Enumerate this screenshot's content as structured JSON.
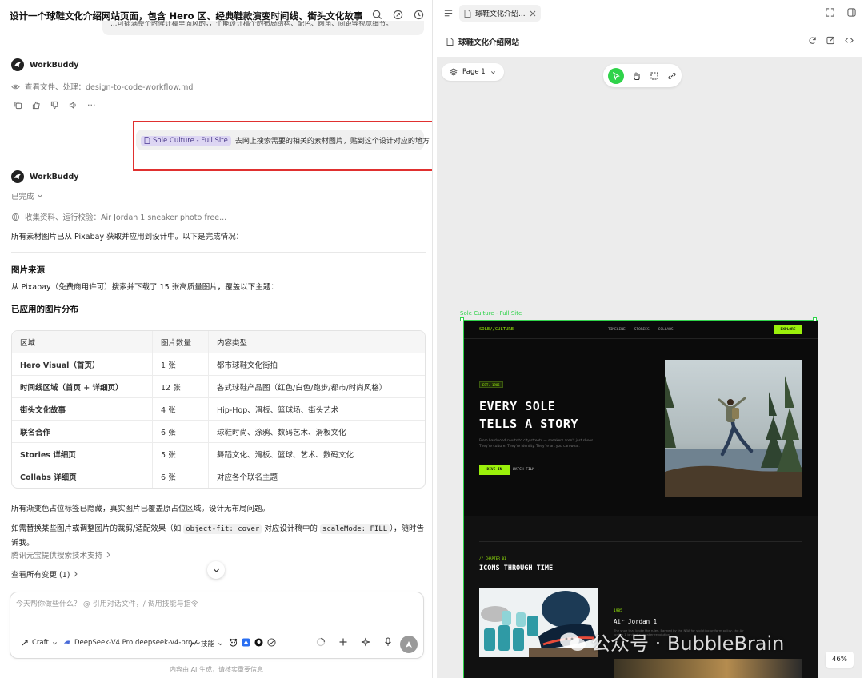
{
  "chat": {
    "title": "设计一个球鞋文化介绍网站页面，包含 Hero 区、经典鞋款演变时间线、街头文化故事、标志...",
    "prev_message_fragment": "…可插满整个时候计稿里面风的，，个能设计稿个的布局结构、配色、圆角、间距等视觉细节。",
    "agent_name": "WorkBuddy",
    "step1": "查看文件、处理：design-to-code-workflow.md",
    "user_msg": {
      "chip": "Sole Culture - Full Site",
      "text": "去网上搜索需要的相关的素材图片，贴到这个设计对应的地方"
    },
    "status": "已完成",
    "step2": "收集资料、运行校验：Air Jordan 1 sneaker photo free...",
    "intro": "所有素材图片已从 Pixabay 获取并应用到设计中。以下是完成情况：",
    "h_source": "图片来源",
    "p_source": "从 Pixabay（免费商用许可）搜索并下载了 15 张高质量图片，覆盖以下主题：",
    "h_dist": "已应用的图片分布",
    "table": {
      "headers": [
        "区域",
        "图片数量",
        "内容类型"
      ],
      "rows": [
        [
          "Hero Visual（首页）",
          "1 张",
          "都市球鞋文化街拍"
        ],
        [
          "时间线区域（首页 + 详细页）",
          "12 张",
          "各式球鞋产品图（红色/白色/跑步/都市/时尚风格）"
        ],
        [
          "街头文化故事",
          "4 张",
          "Hip-Hop、滑板、篮球场、街头艺术"
        ],
        [
          "联名合作",
          "6 张",
          "球鞋时尚、涂鸦、数码艺术、滑板文化"
        ],
        [
          "Stories 详细页",
          "5 张",
          "舞蹈文化、滑板、篮球、艺术、数码文化"
        ],
        [
          "Collabs 详细页",
          "6 张",
          "对应各个联名主题"
        ]
      ]
    },
    "p_hidden": "所有渐变色占位标签已隐藏，真实图片已覆盖原占位区域。设计无布局问题。",
    "p_replace_a": "如需替换某些图片或调整图片的裁剪/适配效果（如 ",
    "code1": "object-fit: cover",
    "p_replace_b": " 对应设计稿中的 ",
    "code2": "scaleMode: FILL",
    "p_replace_c": "），随时告诉我。",
    "tencent": "腾讯元宝提供搜索技术支持",
    "changes": "查看所有变更 (1)",
    "input_placeholder": "今天帮你做些什么？ @ 引用对话文件，/ 调用技能与指令",
    "tool_craft": "Craft",
    "tool_model": "DeepSeek-V4 Pro:deepseek-v4-pro",
    "tool_skill": "技能",
    "footer": "内容由 AI 生成，请核实重要信息"
  },
  "preview": {
    "tab_label": "球鞋文化介绍...",
    "page_title": "球鞋文化介绍网站",
    "page_select": "Page 1",
    "frame_label": "Sole Culture - Full Site",
    "zoom": "46%",
    "site": {
      "logo": "SOLE//CULTURE",
      "nav": [
        "TIMELINE",
        "STORIES",
        "COLLABS"
      ],
      "cta": "EXPLORE",
      "tag": "EST. 1985",
      "hero_line1": "EVERY SOLE",
      "hero_line2": "TELLS A STORY",
      "hero_sub1": "From hardwood courts to city streets — sneakers aren't just shoes.",
      "hero_sub2": "They're culture. They're identity. They're art you can wear.",
      "btn_primary": "DIVE IN",
      "btn_secondary": "WATCH FILM →",
      "chapter": "// CHAPTER 01",
      "section_title": "ICONS THROUGH TIME",
      "year": "1985",
      "shoe_name": "Air Jordan 1",
      "shoe_desc": "The shoe that broke the rules. Banned by the NBA for violating uniform policy, the Air Jordan 1 ignited a sneaker revolution."
    }
  },
  "watermark": "公众号 · BubbleBrain",
  "colors": {
    "accent_green": "#9bf00b",
    "select_green": "#2fd34a",
    "highlight_red": "#e0302f"
  }
}
